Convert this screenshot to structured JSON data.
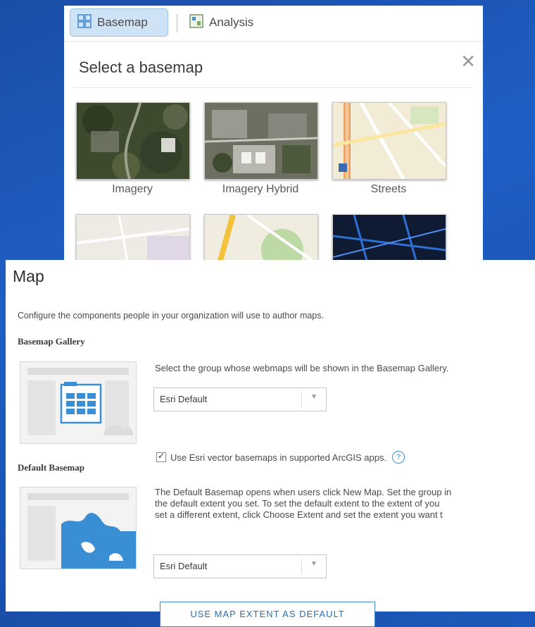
{
  "popup": {
    "tabs": [
      {
        "label": "Basemap",
        "icon": "basemap-grid-icon",
        "active": true
      },
      {
        "label": "Analysis",
        "icon": "analysis-icon",
        "active": false
      }
    ],
    "title": "Select a basemap",
    "close_icon": "close-icon",
    "basemaps": [
      {
        "label": "Imagery"
      },
      {
        "label": "Imagery Hybrid"
      },
      {
        "label": "Streets"
      },
      {
        "label": ""
      },
      {
        "label": ""
      },
      {
        "label": ""
      }
    ]
  },
  "panel": {
    "title": "Map",
    "description": "Configure the components people in your organization will use to author maps.",
    "basemap_gallery": {
      "heading": "Basemap Gallery",
      "text": "Select the group whose webmaps will be shown in the Basemap Gallery.",
      "select_value": "Esri Default",
      "checkbox_label": "Use Esri vector basemaps in supported ArcGIS apps.",
      "checkbox_checked": true
    },
    "default_basemap": {
      "heading": "Default Basemap",
      "text_lines": [
        "The Default Basemap opens when users click New Map. Set the group in",
        "the default extent you set. To set the default extent to the extent of you",
        "set a different extent, click Choose Extent and set the extent you want t"
      ],
      "select_value": "Esri Default",
      "button_label": "USE MAP EXTENT AS DEFAULT"
    }
  },
  "colors": {
    "accent": "#3a86c8",
    "background": "#1f5fc4"
  }
}
